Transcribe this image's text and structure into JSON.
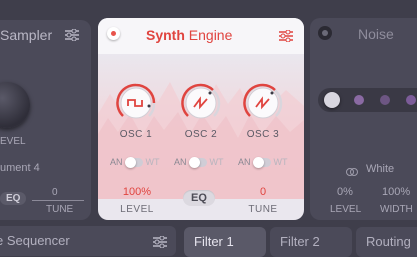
{
  "left_panel": {
    "title": "Sampler",
    "level_label": "EVEL",
    "instrument_label": "ument 4",
    "eq_label": "EQ",
    "tune_value": "0",
    "tune_label": "TUNE"
  },
  "synth": {
    "title_bold": "Synth",
    "title_rest": " Engine",
    "accent": "#e0443f",
    "oscillators": [
      {
        "label": "OSC 1",
        "wave": "square",
        "toggle_left": "AN",
        "toggle_right": "WT"
      },
      {
        "label": "OSC 2",
        "wave": "saw",
        "toggle_left": "AN",
        "toggle_right": "WT"
      },
      {
        "label": "OSC 3",
        "wave": "saw",
        "toggle_left": "AN",
        "toggle_right": "WT"
      }
    ],
    "level_value": "100%",
    "level_label": "LEVEL",
    "eq_label": "EQ",
    "tune_value": "0",
    "tune_label": "TUNE"
  },
  "noise_panel": {
    "title": "Noise",
    "type_label": "White",
    "level_value": "0%",
    "level_label": "LEVEL",
    "width_value": "100%",
    "width_label": "WIDTH"
  },
  "bottom": {
    "sequencer_label": "e Sequencer",
    "tabs": [
      {
        "label": "Filter 1",
        "active": true
      },
      {
        "label": "Filter 2",
        "active": false
      },
      {
        "label": "Routing",
        "active": false
      }
    ]
  },
  "icons": {
    "menu": "sliders-icon",
    "power": "power-icon",
    "noise_white": "circles-icon"
  }
}
